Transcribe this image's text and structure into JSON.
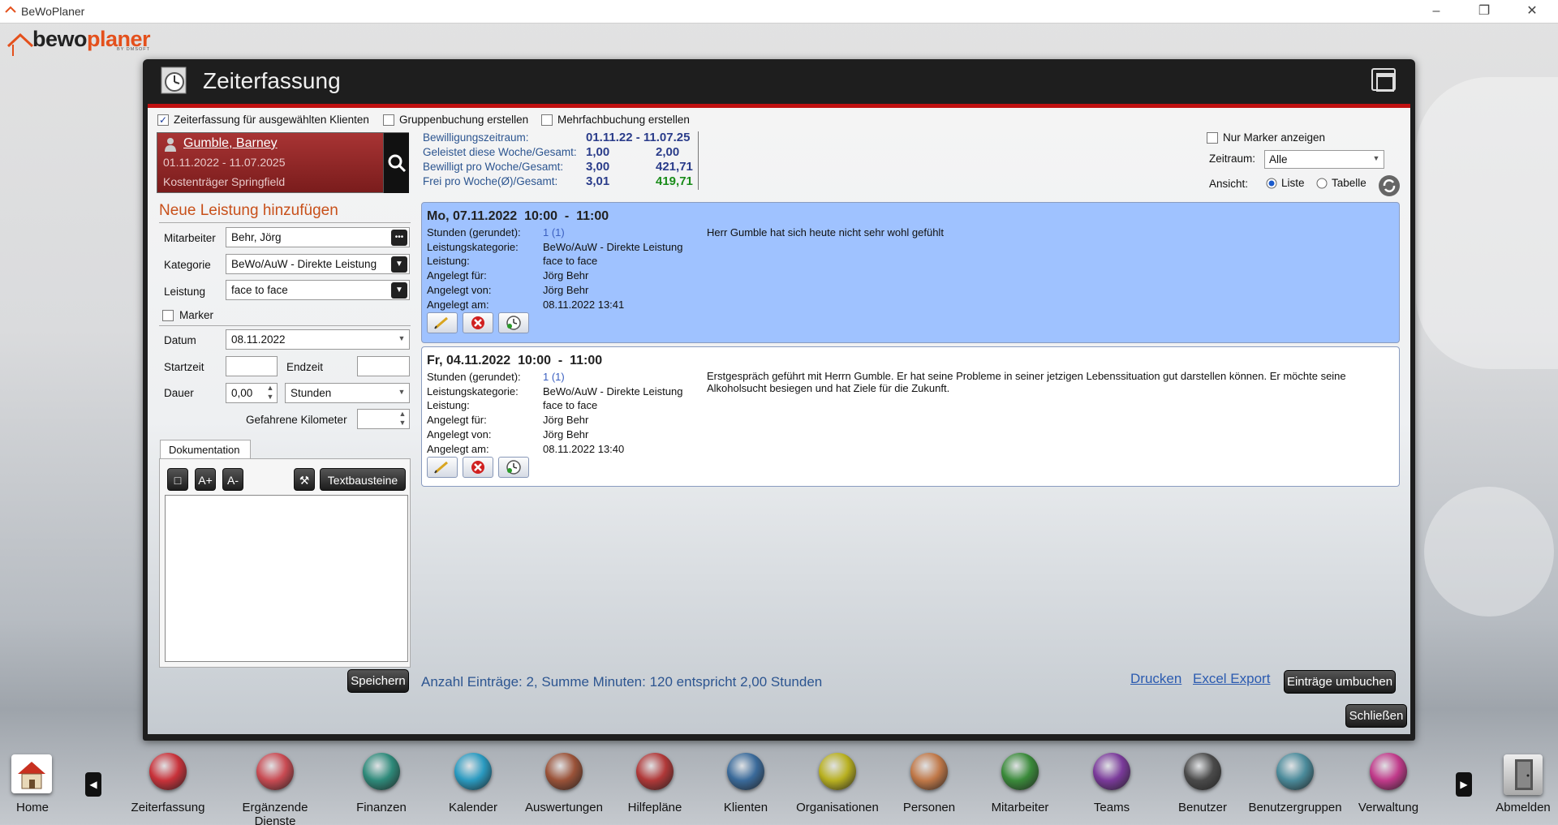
{
  "app": {
    "title": "BeWoPlaner"
  },
  "logo": {
    "brand_dark": "bewo",
    "brand_orange": "planer",
    "tagline": "BY DMSOFT"
  },
  "window": {
    "title": "Zeiterfassung"
  },
  "options": {
    "clients_label": "Zeiterfassung für ausgewählten Klienten",
    "clients_checked": true,
    "group_label": "Gruppenbuchung erstellen",
    "multi_label": "Mehrfachbuchung erstellen"
  },
  "client": {
    "name": "Gumble, Barney",
    "period": "01.11.2022 - 11.07.2025",
    "cost": "Kostenträger Springfield"
  },
  "stats": {
    "rows": [
      {
        "label": "Bewilligungszeitraum:",
        "v1": "01.11.22 - 11.07.25",
        "v2": ""
      },
      {
        "label": "Geleistet diese Woche/Gesamt:",
        "v1": "1,00",
        "v2": "2,00"
      },
      {
        "label": "Bewilligt pro Woche/Gesamt:",
        "v1": "3,00",
        "v2": "421,71"
      },
      {
        "label": "Frei pro Woche(Ø)/Gesamt:",
        "v1": "3,01",
        "v2": "419,71"
      }
    ]
  },
  "filters": {
    "marker_only": "Nur Marker anzeigen",
    "zeitraum_label": "Zeitraum:",
    "zeitraum_value": "Alle",
    "ansicht_label": "Ansicht:",
    "liste": "Liste",
    "tabelle": "Tabelle"
  },
  "form": {
    "heading": "Neue Leistung hinzufügen",
    "mitarbeiter_label": "Mitarbeiter",
    "mitarbeiter_value": "Behr, Jörg",
    "kategorie_label": "Kategorie",
    "kategorie_value": "BeWo/AuW - Direkte Leistung",
    "leistung_label": "Leistung",
    "leistung_value": "face to face",
    "marker_label": "Marker",
    "datum_label": "Datum",
    "datum_value": "08.11.2022",
    "startzeit_label": "Startzeit",
    "endzeit_label": "Endzeit",
    "dauer_label": "Dauer",
    "dauer_value": "0,00",
    "dauer_unit": "Stunden",
    "km_label": "Gefahrene Kilometer"
  },
  "doc": {
    "tab": "Dokumentation",
    "btn_box": "□",
    "btn_plus": "A+",
    "btn_minus": "A-",
    "btn_text": "Textbausteine",
    "tool_icon": "⚒"
  },
  "entries": [
    {
      "header": "Mo, 07.11.2022  10:00  -  11:00",
      "stunden_label": "Stunden (gerundet):",
      "stunden": "1 (1)",
      "kat_label": "Leistungskategorie:",
      "kat": "BeWo/AuW - Direkte Leistung",
      "leist_label": "Leistung:",
      "leist": "face to face",
      "fuer_label": "Angelegt für:",
      "fuer": "Jörg Behr",
      "von_label": "Angelegt von:",
      "von": "Jörg Behr",
      "am_label": "Angelegt am:",
      "am": "08.11.2022 13:41",
      "note": "Herr Gumble hat sich heute nicht sehr wohl gefühlt"
    },
    {
      "header": "Fr, 04.11.2022  10:00  -  11:00",
      "stunden_label": "Stunden (gerundet):",
      "stunden": "1 (1)",
      "kat_label": "Leistungskategorie:",
      "kat": "BeWo/AuW - Direkte Leistung",
      "leist_label": "Leistung:",
      "leist": "face to face",
      "fuer_label": "Angelegt für:",
      "fuer": "Jörg Behr",
      "von_label": "Angelegt von:",
      "von": "Jörg Behr",
      "am_label": "Angelegt am:",
      "am": "08.11.2022 13:40",
      "note": "Erstgespräch geführt mit Herrn Gumble. Er hat seine Probleme in seiner jetzigen Lebenssituation gut darstellen können. Er möchte seine Alkoholsucht besiegen und hat Ziele für die Zukunft."
    }
  ],
  "footer": {
    "save": "Speichern",
    "summary": "Anzahl Einträge: 2, Summe Minuten: 120 entspricht 2,00 Stunden",
    "print": "Drucken",
    "excel": "Excel Export",
    "rebook": "Einträge umbuchen",
    "close": "Schließen"
  },
  "dock": {
    "home": "Home",
    "logout": "Abmelden",
    "items": [
      {
        "label": "Zeiterfassung",
        "color": "#c8323a"
      },
      {
        "label": "Ergänzende Dienste",
        "color": "#c84a52"
      },
      {
        "label": "Finanzen",
        "color": "#2e8a7a"
      },
      {
        "label": "Kalender",
        "color": "#2a9ac0"
      },
      {
        "label": "Auswertungen",
        "color": "#9a5238"
      },
      {
        "label": "Hilfepläne",
        "color": "#b03838"
      },
      {
        "label": "Klienten",
        "color": "#3a6a9a"
      },
      {
        "label": "Organisationen",
        "color": "#b8b020"
      },
      {
        "label": "Personen",
        "color": "#c07848"
      },
      {
        "label": "Mitarbeiter",
        "color": "#3a8a3a"
      },
      {
        "label": "Teams",
        "color": "#7a3a9a"
      },
      {
        "label": "Benutzer",
        "color": "#4a4a4a"
      },
      {
        "label": "Benutzergruppen",
        "color": "#4a8a9a"
      },
      {
        "label": "Verwaltung",
        "color": "#c03a8a"
      }
    ]
  },
  "colors": {
    "accent_red": "#c01010",
    "entry_selected": "#9fc2ff",
    "orange": "#e4501c"
  }
}
